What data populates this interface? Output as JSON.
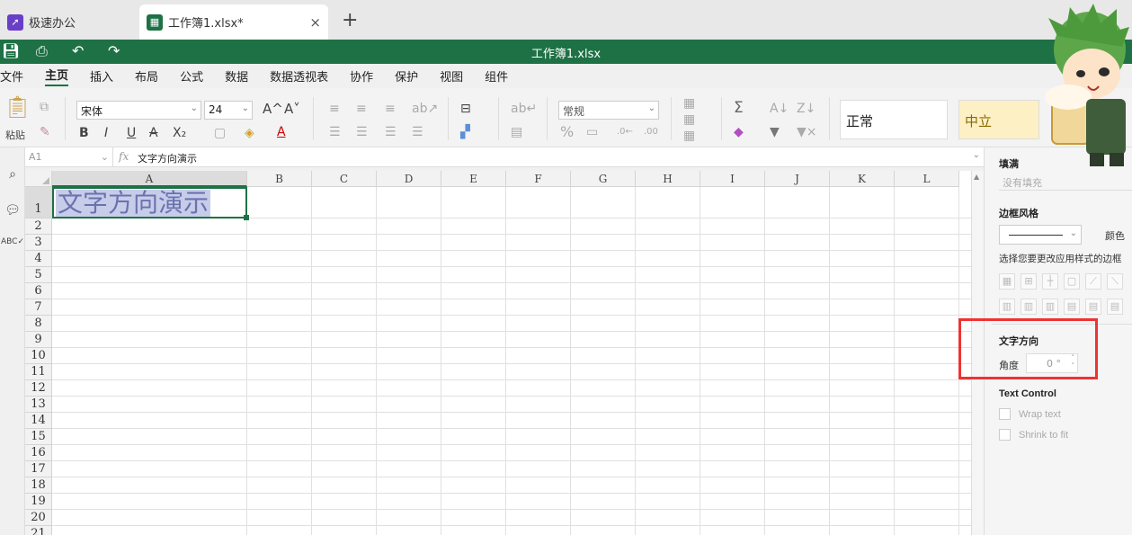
{
  "tabs": {
    "home": "极速办公",
    "file": "工作簿1.xlsx*",
    "new": "+",
    "close": "×"
  },
  "window": {
    "title": "工作簿1.xlsx",
    "brand_color": "#1e7145"
  },
  "menu": [
    "文件",
    "主页",
    "插入",
    "布局",
    "公式",
    "数据",
    "数据透视表",
    "协作",
    "保护",
    "视图",
    "组件"
  ],
  "ribbon": {
    "paste": "粘贴",
    "font": "宋体",
    "size": "24",
    "number_format": "常规",
    "style_normal": "正常",
    "style_neutral": "中立",
    "bold": "B",
    "italic": "I",
    "underline": "U",
    "strike": "A",
    "sub": "X₂",
    "grow": "A^",
    "shrink": "A˅",
    "fontcolor": "A",
    "percent": "%",
    "sum": "Σ"
  },
  "formula_bar": {
    "cell": "A1",
    "fx": "fx",
    "value": "文字方向演示"
  },
  "sheet": {
    "columns": [
      "A",
      "B",
      "C",
      "D",
      "E",
      "F",
      "G",
      "H",
      "I",
      "J",
      "K",
      "L"
    ],
    "rows": [
      "1",
      "2",
      "3",
      "4",
      "5",
      "6",
      "7",
      "8",
      "9",
      "10",
      "11",
      "12",
      "13",
      "14",
      "15",
      "16",
      "17",
      "18",
      "19",
      "20",
      "21"
    ],
    "a1": "文字方向演示"
  },
  "panel": {
    "fill_title": "填满",
    "fill_value": "没有填充",
    "border_title": "边框风格",
    "color_label": "颜色",
    "border_hint": "选择您要更改应用样式的边框",
    "orient_title": "文字方向",
    "angle_label": "角度",
    "angle_value": "0 °",
    "text_control": "Text Control",
    "wrap": "Wrap text",
    "shrink": "Shrink to fit"
  }
}
